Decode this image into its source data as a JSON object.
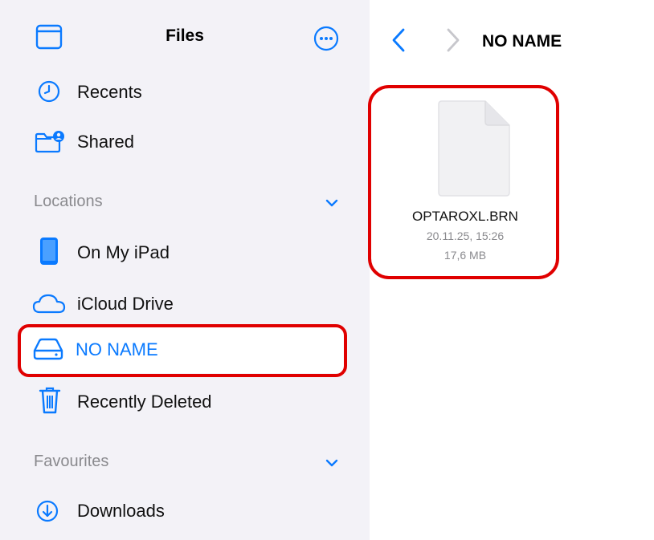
{
  "sidebar": {
    "title": "Files",
    "items": [
      {
        "label": "Recents",
        "icon": "clock-icon"
      },
      {
        "label": "Shared",
        "icon": "shared-folder-icon"
      }
    ],
    "locations": {
      "header": "Locations",
      "items": [
        {
          "label": "On My iPad",
          "icon": "ipad-icon"
        },
        {
          "label": "iCloud Drive",
          "icon": "cloud-icon"
        },
        {
          "label": "NO NAME",
          "icon": "drive-icon",
          "selected": true
        },
        {
          "label": "Recently Deleted",
          "icon": "trash-icon"
        }
      ]
    },
    "favourites": {
      "header": "Favourites",
      "items": [
        {
          "label": "Downloads",
          "icon": "download-icon"
        }
      ]
    }
  },
  "main": {
    "title": "NO NAME",
    "file": {
      "name": "OPTAROXL.BRN",
      "date": "20.11.25, 15:26",
      "size": "17,6 MB",
      "icon": "document-icon"
    }
  },
  "colors": {
    "accent": "#0a7aff",
    "highlight": "#e00000",
    "sidebar_bg": "#f3f2f7"
  }
}
